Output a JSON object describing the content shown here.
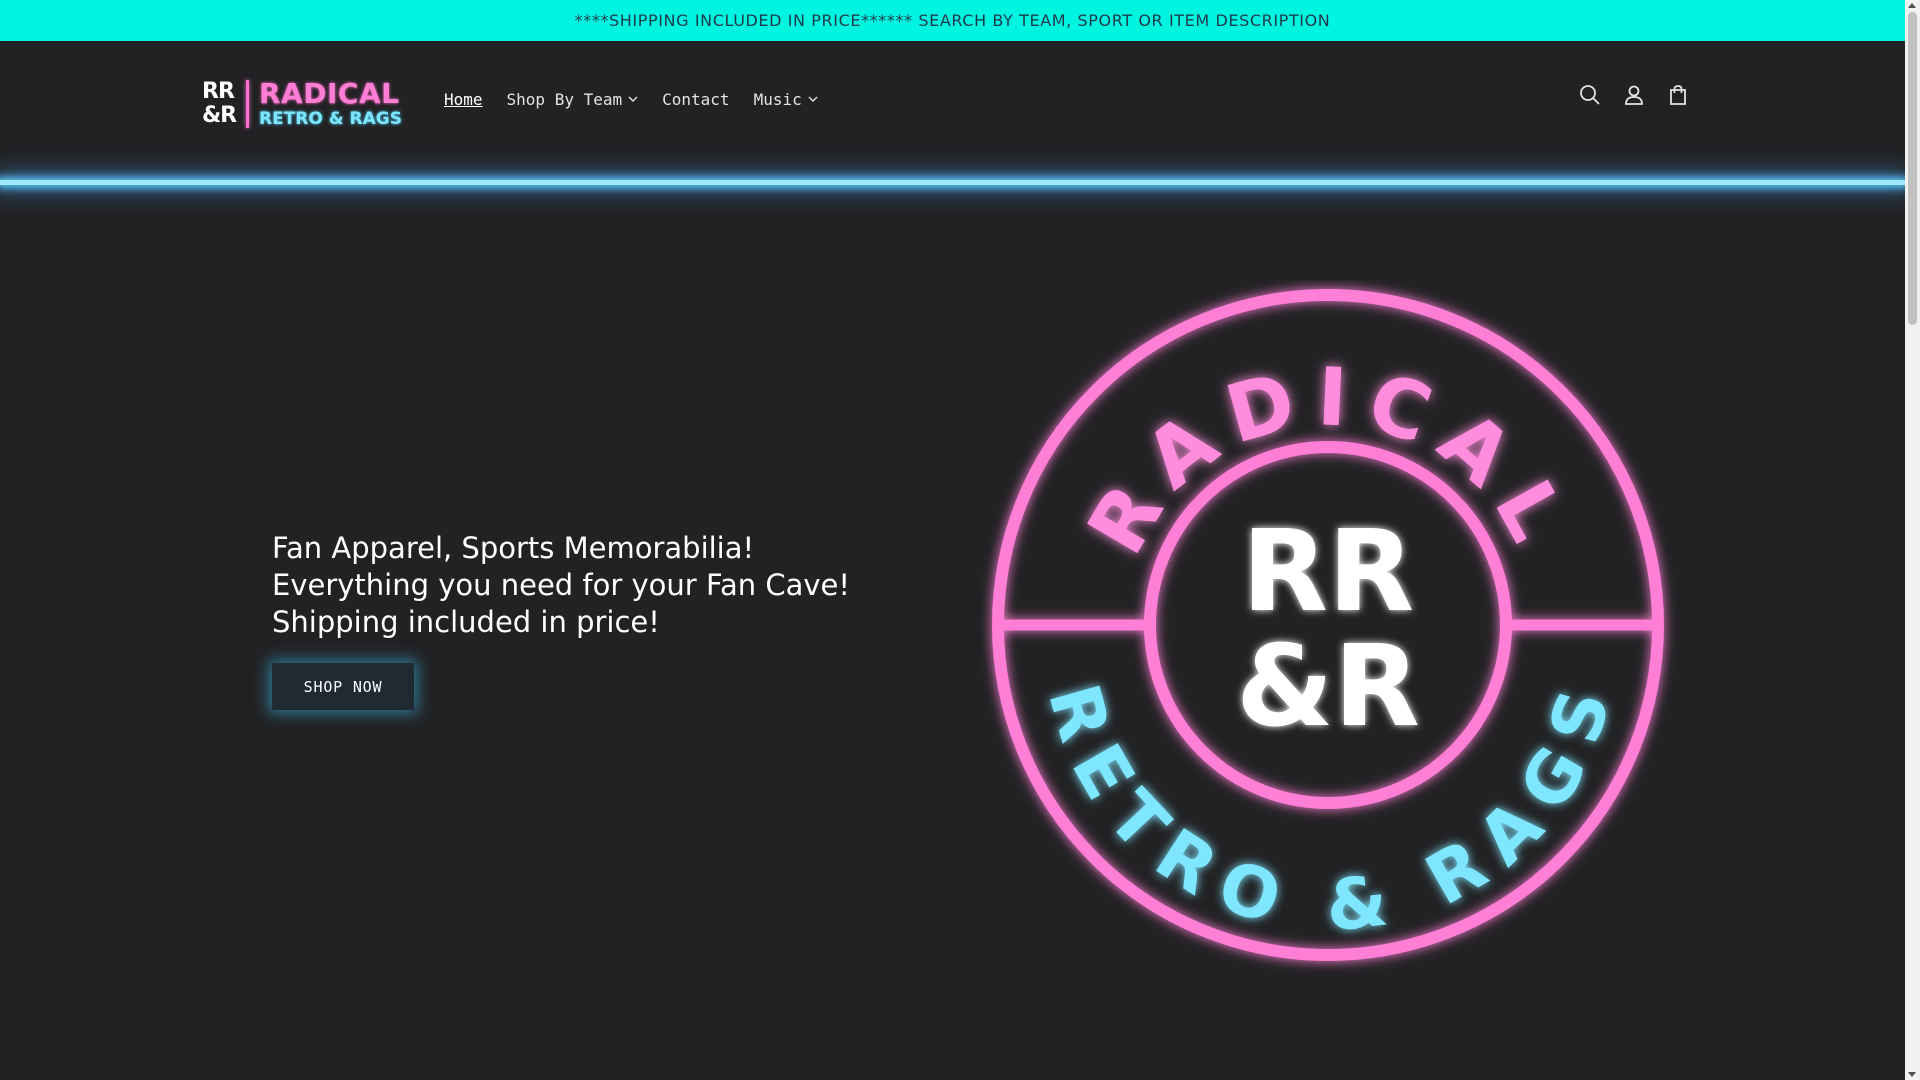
{
  "announcement": {
    "text": "****SHIPPING INCLUDED IN PRICE****** SEARCH BY TEAM, SPORT OR ITEM DESCRIPTION"
  },
  "header": {
    "logo": {
      "monogram_line1": "RR",
      "monogram_line2": "&R",
      "word1": "RADICAL",
      "word2": "RETRO & RAGS"
    },
    "nav": [
      {
        "label": "Home",
        "active": true,
        "has_dropdown": false
      },
      {
        "label": "Shop By Team",
        "active": false,
        "has_dropdown": true
      },
      {
        "label": "Contact",
        "active": false,
        "has_dropdown": false
      },
      {
        "label": "Music",
        "active": false,
        "has_dropdown": true
      }
    ],
    "icons": [
      "search-icon",
      "account-icon",
      "cart-icon"
    ]
  },
  "hero": {
    "lines": [
      "Fan Apparel, Sports Memorabilia!",
      "Everything you need for your Fan Cave!",
      "Shipping included in price!"
    ],
    "button_label": "SHOP NOW",
    "badge": {
      "top_text": "RADICAL",
      "center_line1": "RR",
      "center_line2": "&R",
      "bottom_text": "RETRO & RAGS"
    }
  },
  "colors": {
    "announcement_bg": "#00f5e1",
    "page_bg": "#222224",
    "neon_pink": "#ff6fcf",
    "neon_blue": "#6fe2ff"
  }
}
